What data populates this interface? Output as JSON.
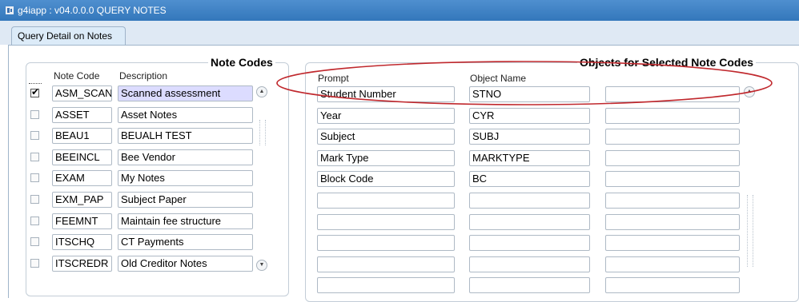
{
  "window": {
    "title": "g4iapp : v04.0.0.0 QUERY NOTES"
  },
  "tabs": [
    {
      "label": "Query Detail on Notes"
    }
  ],
  "note_codes": {
    "title": "Note Codes",
    "col_code": "Note Code",
    "col_desc": "Description",
    "rows": [
      {
        "checked": true,
        "code": "ASM_SCAN",
        "description": "Scanned assessment"
      },
      {
        "checked": false,
        "code": "ASSET",
        "description": "Asset Notes"
      },
      {
        "checked": false,
        "code": "BEAU1",
        "description": "BEUALH TEST"
      },
      {
        "checked": false,
        "code": "BEEINCL",
        "description": "Bee Vendor"
      },
      {
        "checked": false,
        "code": "EXAM",
        "description": "My Notes"
      },
      {
        "checked": false,
        "code": "EXM_PAP",
        "description": "Subject  Paper"
      },
      {
        "checked": false,
        "code": "FEEMNT",
        "description": "Maintain fee structure"
      },
      {
        "checked": false,
        "code": "ITSCHQ",
        "description": "CT Payments"
      },
      {
        "checked": false,
        "code": "ITSCREDR",
        "description": "Old Creditor Notes"
      }
    ]
  },
  "objects": {
    "title": "Objects for Selected Note Codes",
    "col_prompt": "Prompt",
    "col_object": "Object Name",
    "rows": [
      {
        "prompt": "Student Number",
        "object": "STNO",
        "extra": ""
      },
      {
        "prompt": "Year",
        "object": "CYR",
        "extra": ""
      },
      {
        "prompt": "Subject",
        "object": "SUBJ",
        "extra": ""
      },
      {
        "prompt": "Mark Type",
        "object": "MARKTYPE",
        "extra": ""
      },
      {
        "prompt": "Block Code",
        "object": "BC",
        "extra": ""
      },
      {
        "prompt": "",
        "object": "",
        "extra": ""
      },
      {
        "prompt": "",
        "object": "",
        "extra": ""
      },
      {
        "prompt": "",
        "object": "",
        "extra": ""
      },
      {
        "prompt": "",
        "object": "",
        "extra": ""
      },
      {
        "prompt": "",
        "object": "",
        "extra": ""
      }
    ]
  },
  "annotation": {
    "color": "#c0282d"
  }
}
